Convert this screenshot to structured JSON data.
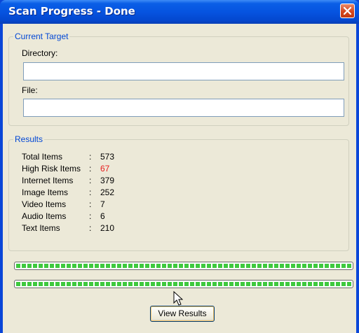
{
  "window": {
    "title": "Scan Progress - Done"
  },
  "current_target": {
    "legend": "Current Target",
    "directory_label": "Directory:",
    "directory_value": "",
    "file_label": "File:",
    "file_value": ""
  },
  "results": {
    "legend": "Results",
    "rows": [
      {
        "label": "Total Items",
        "colon": ":",
        "value": "573"
      },
      {
        "label": "High Risk Items",
        "colon": ":",
        "value": "67",
        "value_color": "#e81c1c"
      },
      {
        "label": "Internet Items",
        "colon": ":",
        "value": "379"
      },
      {
        "label": "Image Items",
        "colon": ":",
        "value": "252"
      },
      {
        "label": "Video Items",
        "colon": ":",
        "value": "7"
      },
      {
        "label": "Audio Items",
        "colon": ":",
        "value": "6"
      },
      {
        "label": "Text Items",
        "colon": ":",
        "value": "210"
      }
    ]
  },
  "progress": [
    {
      "fraction": 1.0
    },
    {
      "fraction": 1.0
    }
  ],
  "buttons": {
    "view_results": "View Results"
  },
  "icons": {
    "close": "close-icon",
    "cursor": "mouse-pointer-icon"
  },
  "colors": {
    "title_bar": "#0654e0",
    "accent": "#0046d5",
    "progress": "#3ec93e",
    "high_risk": "#e81c1c"
  }
}
